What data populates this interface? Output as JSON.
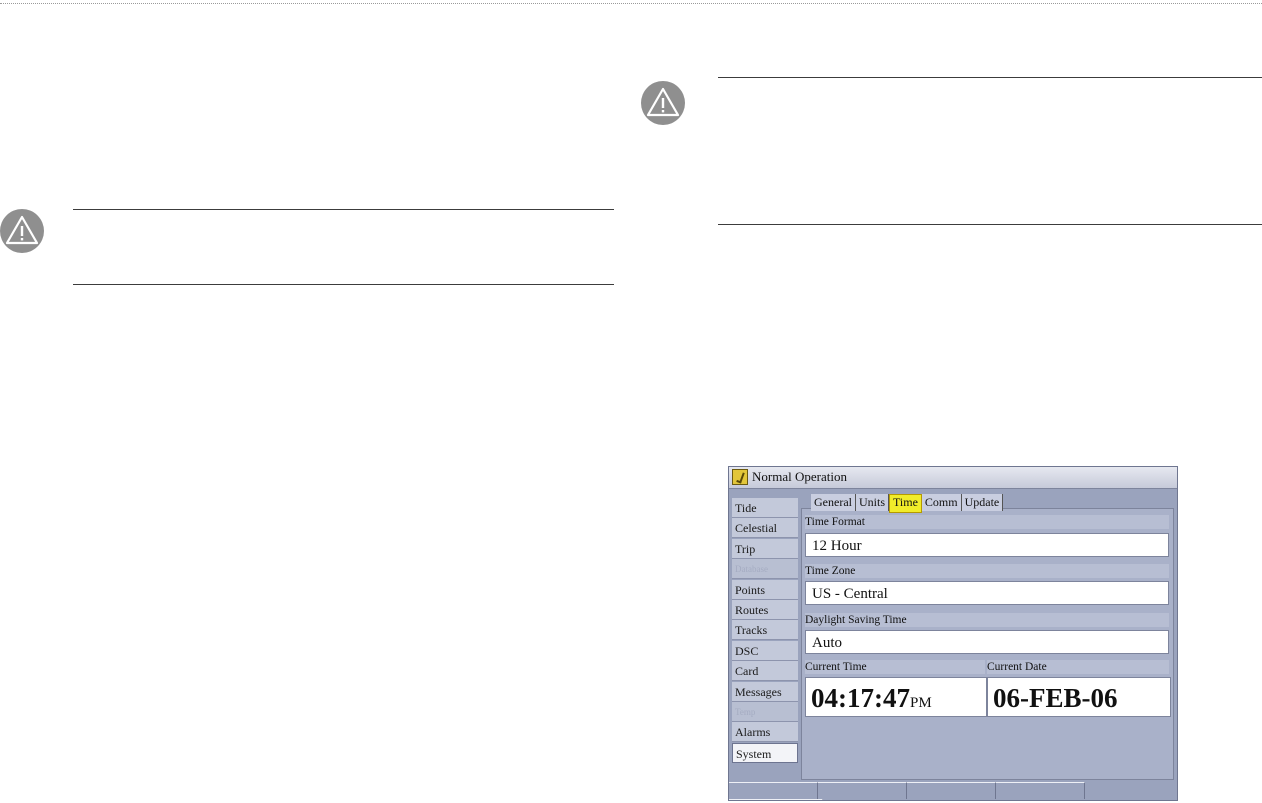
{
  "screen": {
    "title": "Normal Operation",
    "sidebar": {
      "items": [
        {
          "label": "Tide"
        },
        {
          "label": "Celestial"
        },
        {
          "label": "Trip"
        },
        {
          "label": "Database"
        },
        {
          "label": "Points"
        },
        {
          "label": "Routes"
        },
        {
          "label": "Tracks"
        },
        {
          "label": "DSC"
        },
        {
          "label": "Card"
        },
        {
          "label": "Messages"
        },
        {
          "label": "Temp"
        },
        {
          "label": "Alarms"
        },
        {
          "label": "System"
        }
      ],
      "selected": "System"
    },
    "tabs": [
      {
        "label": "General"
      },
      {
        "label": "Units"
      },
      {
        "label": "Time"
      },
      {
        "label": "Comm"
      },
      {
        "label": "Update"
      }
    ],
    "active_tab": "Time",
    "fields": {
      "time_format": {
        "label": "Time Format",
        "value": "12 Hour"
      },
      "time_zone": {
        "label": "Time Zone",
        "value": "US - Central"
      },
      "dst": {
        "label": "Daylight Saving Time",
        "value": "Auto"
      },
      "current_time": {
        "label": "Current Time",
        "value": "04:17:47",
        "ampm": "PM"
      },
      "current_date": {
        "label": "Current Date",
        "value": "06-FEB-06"
      }
    }
  },
  "colors": {
    "screen_bg": "#9aa3bd",
    "active_tab": "#f1ec2a",
    "warning_icon": "#8f8f8f"
  }
}
